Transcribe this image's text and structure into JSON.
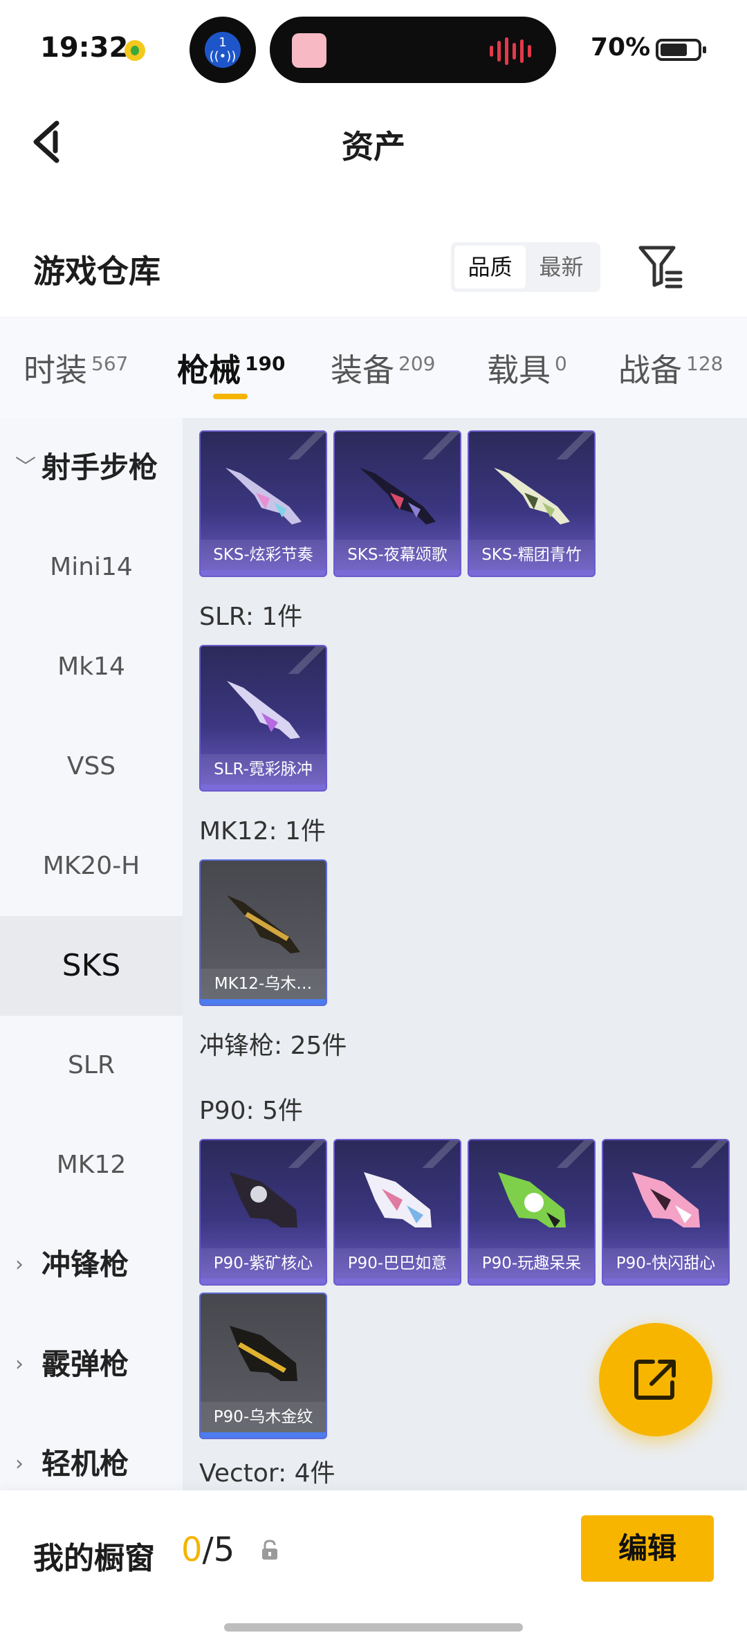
{
  "status_bar": {
    "time": "19:32",
    "battery_percent": "70%",
    "notification_badge": "1"
  },
  "header": {
    "title": "资产",
    "back_icon": "chevron-left-icon"
  },
  "warehouse": {
    "title": "游戏仓库",
    "sort_options": [
      "品质",
      "最新"
    ],
    "sort_selected": "品质",
    "filter_icon": "filter-icon"
  },
  "category_tabs": [
    {
      "label": "时装",
      "count": "567"
    },
    {
      "label": "枪械",
      "count": "190"
    },
    {
      "label": "装备",
      "count": "209"
    },
    {
      "label": "载具",
      "count": "0"
    },
    {
      "label": "战备",
      "count": "128"
    }
  ],
  "category_selected": "枪械",
  "sidebar": {
    "groups": [
      {
        "label": "射手步枪",
        "expanded": true
      },
      {
        "label": "冲锋枪",
        "expanded": false
      },
      {
        "label": "霰弹枪",
        "expanded": false
      },
      {
        "label": "轻机枪",
        "expanded": false
      }
    ],
    "items": [
      "Mini14",
      "Mk14",
      "VSS",
      "MK20-H",
      "SKS",
      "SLR",
      "MK12"
    ],
    "selected": "SKS"
  },
  "content": {
    "sks_cards": [
      "SKS-炫彩节奏",
      "SKS-夜幕颂歌",
      "SKS-糯团青竹"
    ],
    "slr_heading": "SLR: 1件",
    "slr_cards": [
      "SLR-霓彩脉冲"
    ],
    "mk12_heading": "MK12: 1件",
    "mk12_cards": [
      "MK12-乌木…"
    ],
    "smg_heading": "冲锋枪: 25件",
    "p90_heading": "P90: 5件",
    "p90_cards": [
      "P90-紫矿核心",
      "P90-巴巴如意",
      "P90-玩趣呆呆",
      "P90-快闪甜心",
      "P90-乌木金纹"
    ],
    "vector_heading": "Vector: 4件"
  },
  "bottom_bar": {
    "showcase_label": "我的橱窗",
    "showcase_used": "0",
    "showcase_total": "/5",
    "edit_label": "编辑"
  },
  "colors": {
    "accent": "#f7b500",
    "card_purple": "#3b3680",
    "card_gray": "#55565d"
  }
}
